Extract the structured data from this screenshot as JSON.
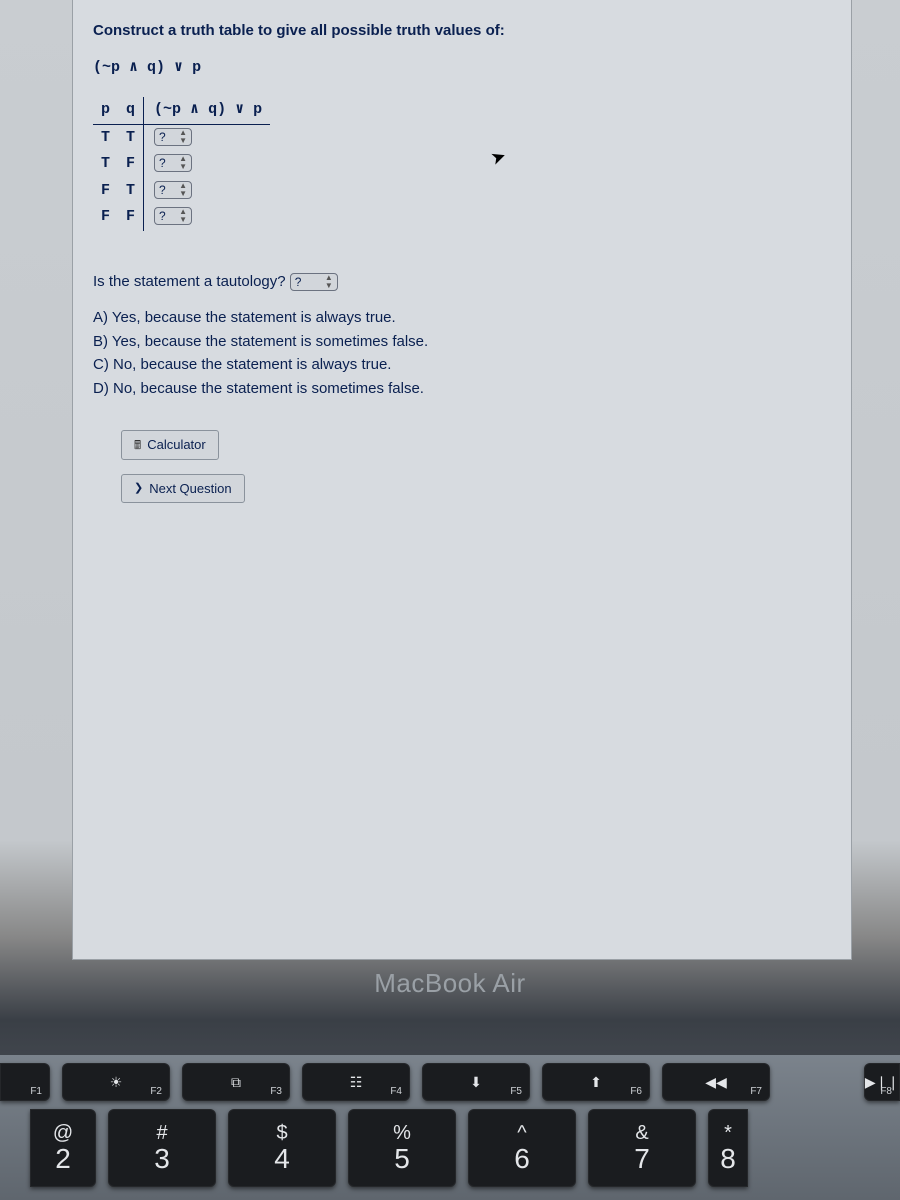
{
  "question": {
    "prompt": "Construct a truth table to give all possible truth values of:",
    "expression": "(~p ∧ q) ∨ p",
    "headers": {
      "p": "p",
      "q": "q",
      "expr": "(~p ∧ q) ∨ p"
    },
    "rows": [
      {
        "p": "T",
        "q": "T",
        "sel": "?"
      },
      {
        "p": "T",
        "q": "F",
        "sel": "?"
      },
      {
        "p": "F",
        "q": "T",
        "sel": "?"
      },
      {
        "p": "F",
        "q": "F",
        "sel": "?"
      }
    ],
    "tautology_prompt": "Is the statement a tautology?",
    "tautology_sel": "?",
    "options": [
      "A) Yes, because the statement is always true.",
      "B) Yes, because the statement is sometimes false.",
      "C) No, because the statement is always true.",
      "D) No, because the statement is sometimes false."
    ],
    "buttons": {
      "calculator": "Calculator",
      "next": "Next Question"
    }
  },
  "hardware": {
    "brand": "MacBook Air",
    "fkeys": [
      {
        "sym": "",
        "lab": "F1"
      },
      {
        "sym": "☀",
        "lab": "F2"
      },
      {
        "sym": "⧉",
        "lab": "F3"
      },
      {
        "sym": "☷",
        "lab": "F4"
      },
      {
        "sym": "⬇",
        "lab": "F5"
      },
      {
        "sym": "⬆",
        "lab": "F6"
      },
      {
        "sym": "◀◀",
        "lab": "F7"
      },
      {
        "sym": "▶❘❘",
        "lab": "F8"
      }
    ],
    "numkeys": [
      {
        "upper": "@",
        "lower": "2"
      },
      {
        "upper": "#",
        "lower": "3"
      },
      {
        "upper": "$",
        "lower": "4"
      },
      {
        "upper": "%",
        "lower": "5"
      },
      {
        "upper": "^",
        "lower": "6"
      },
      {
        "upper": "&",
        "lower": "7"
      },
      {
        "upper": "*",
        "lower": "8"
      }
    ]
  }
}
